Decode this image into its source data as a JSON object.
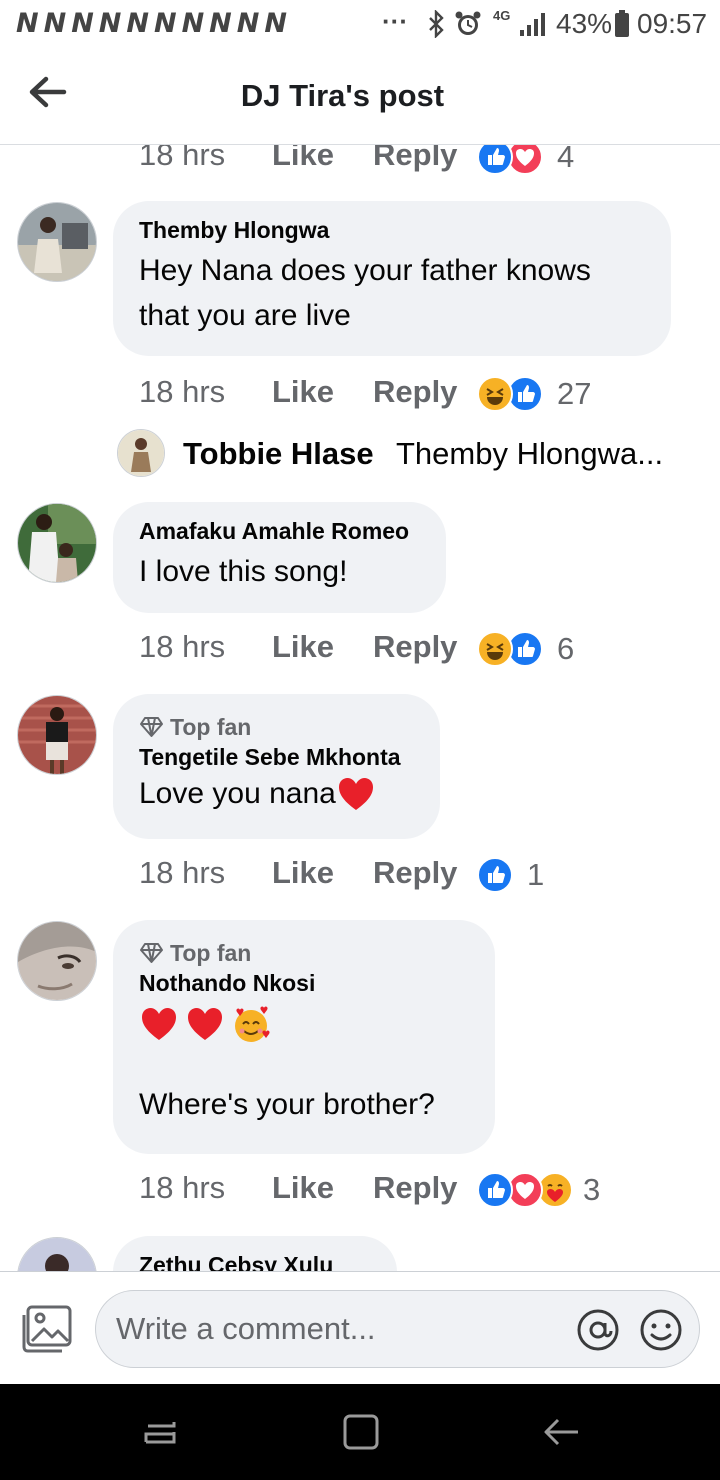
{
  "status_bar": {
    "notification_icons": "NNNNNNNNNN",
    "overflow": "···",
    "network_type": "4G",
    "battery": "43%",
    "time": "09:57"
  },
  "header": {
    "title": "DJ Tira's post"
  },
  "actions": {
    "time": "18 hrs",
    "like": "Like",
    "reply": "Reply"
  },
  "comments": [
    {
      "author": "",
      "text": "",
      "reactions": [
        "like-icon",
        "love-icon"
      ],
      "reaction_count": "4"
    },
    {
      "author": "Themby Hlongwa",
      "text_lines": [
        "Hey Nana does your father knows",
        "that you are live"
      ],
      "reactions": [
        "haha-icon",
        "like-icon"
      ],
      "reaction_count": "27",
      "reply_preview": {
        "author": "Tobbie Hlase",
        "text": "Themby Hlongwa..."
      }
    },
    {
      "author": "Amafaku Amahle Romeo",
      "text": "I love this song!",
      "reactions": [
        "haha-icon",
        "like-icon"
      ],
      "reaction_count": "6"
    },
    {
      "badge": "Top fan",
      "author": "Tengetile Sebe Mkhonta",
      "text": "Love you nana",
      "text_emoji": "heart-emoji",
      "reactions": [
        "like-icon"
      ],
      "reaction_count": "1"
    },
    {
      "badge": "Top fan",
      "author": "Nothando Nkosi",
      "emojis": [
        "heart-emoji",
        "heart-emoji",
        "smiling-face-with-hearts-emoji"
      ],
      "text": "Where's your brother?",
      "reactions": [
        "like-icon",
        "love-icon",
        "care-icon"
      ],
      "reaction_count": "3"
    },
    {
      "author": "Zethu Cebsy Xulu"
    }
  ],
  "composer": {
    "placeholder": "Write a comment..."
  },
  "colors": {
    "like_blue": "#1877f2",
    "love_red": "#f33e58",
    "haha_yellow": "#f7b125",
    "bubble_gray": "#f0f2f5",
    "meta_gray": "#65676b"
  }
}
